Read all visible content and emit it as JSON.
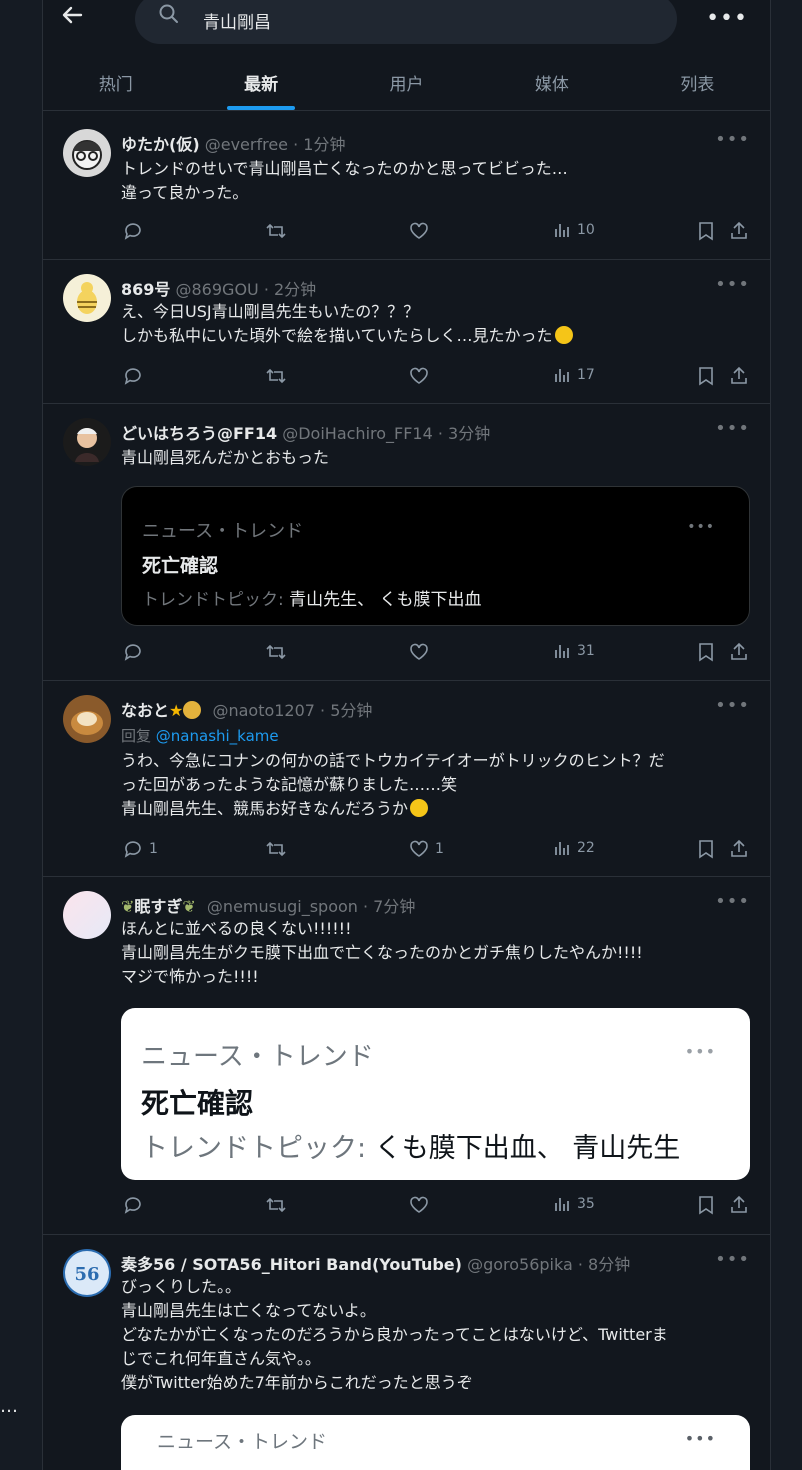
{
  "header": {
    "search_query": "青山剛昌",
    "tabs": [
      "热门",
      "最新",
      "用户",
      "媒体",
      "列表"
    ]
  },
  "tweets": [
    {
      "name": "ゆたか(仮)",
      "handle": "@everfree · 1分钟",
      "lines": [
        "トレンドのせいで青山剛昌亡くなったのかと思ってビビった…",
        "違って良かった。"
      ],
      "views": "10"
    },
    {
      "name": "869号",
      "handle": "@869GOU · 2分钟",
      "lines": [
        "え、今日USJ青山剛昌先生もいたの？？？",
        "しかも私中にいた頃外で絵を描いていたらしく…見たかった"
      ],
      "views": "17"
    },
    {
      "name": "どいはちろう@FF14",
      "handle": "@DoiHachiro_FF14 · 3分钟",
      "lines": [
        "青山剛昌死んだかとおもった"
      ],
      "card": {
        "category": "ニュース・トレンド",
        "title": "死亡確認",
        "topic_prefix": "トレンドトピック:",
        "topics": "青山先生、 くも膜下出血"
      },
      "views": "31"
    },
    {
      "name": "なおと",
      "handle": "@naoto1207 · 5分钟",
      "reply_prefix": "回复",
      "reply_to": "@nanashi_kame",
      "lines": [
        "うわ、今急にコナンの何かの話でトウカイテイオーがトリックのヒント？だ",
        "った回があったような記憶が蘇りました……笑",
        "青山剛昌先生、競馬お好きなんだろうか"
      ],
      "replies": "1",
      "likes": "1",
      "views": "22"
    },
    {
      "name": "眠すぎ",
      "handle": "@nemusugi_spoon · 7分钟",
      "lines": [
        "ほんとに並べるの良くない!!!!!!",
        "青山剛昌先生がクモ膜下出血で亡くなったのかとガチ焦りしたやんか!!!!",
        "マジで怖かった!!!!"
      ],
      "card": {
        "category": "ニュース・トレンド",
        "title": "死亡確認",
        "topic_prefix": "トレンドトピック:",
        "topics": "くも膜下出血、 青山先生"
      },
      "views": "35"
    },
    {
      "name": "奏多56 / SOTA56_Hitori Band(YouTube)",
      "handle": "@goro56pika · 8分钟",
      "lines": [
        "びっくりした。。",
        "青山剛昌先生は亡くなってないよ。",
        "どなたかが亡くなったのだろうから良かったってことはないけど、Twitterま",
        "じでこれ何年直さん気や。。",
        "僕がTwitter始めた7年前からこれだったと思うぞ"
      ],
      "card": {
        "category": "ニュース・トレンド"
      }
    }
  ],
  "colors": {
    "accent": "#1d9bf0",
    "bg": "#12171e",
    "muted": "#71767b"
  }
}
